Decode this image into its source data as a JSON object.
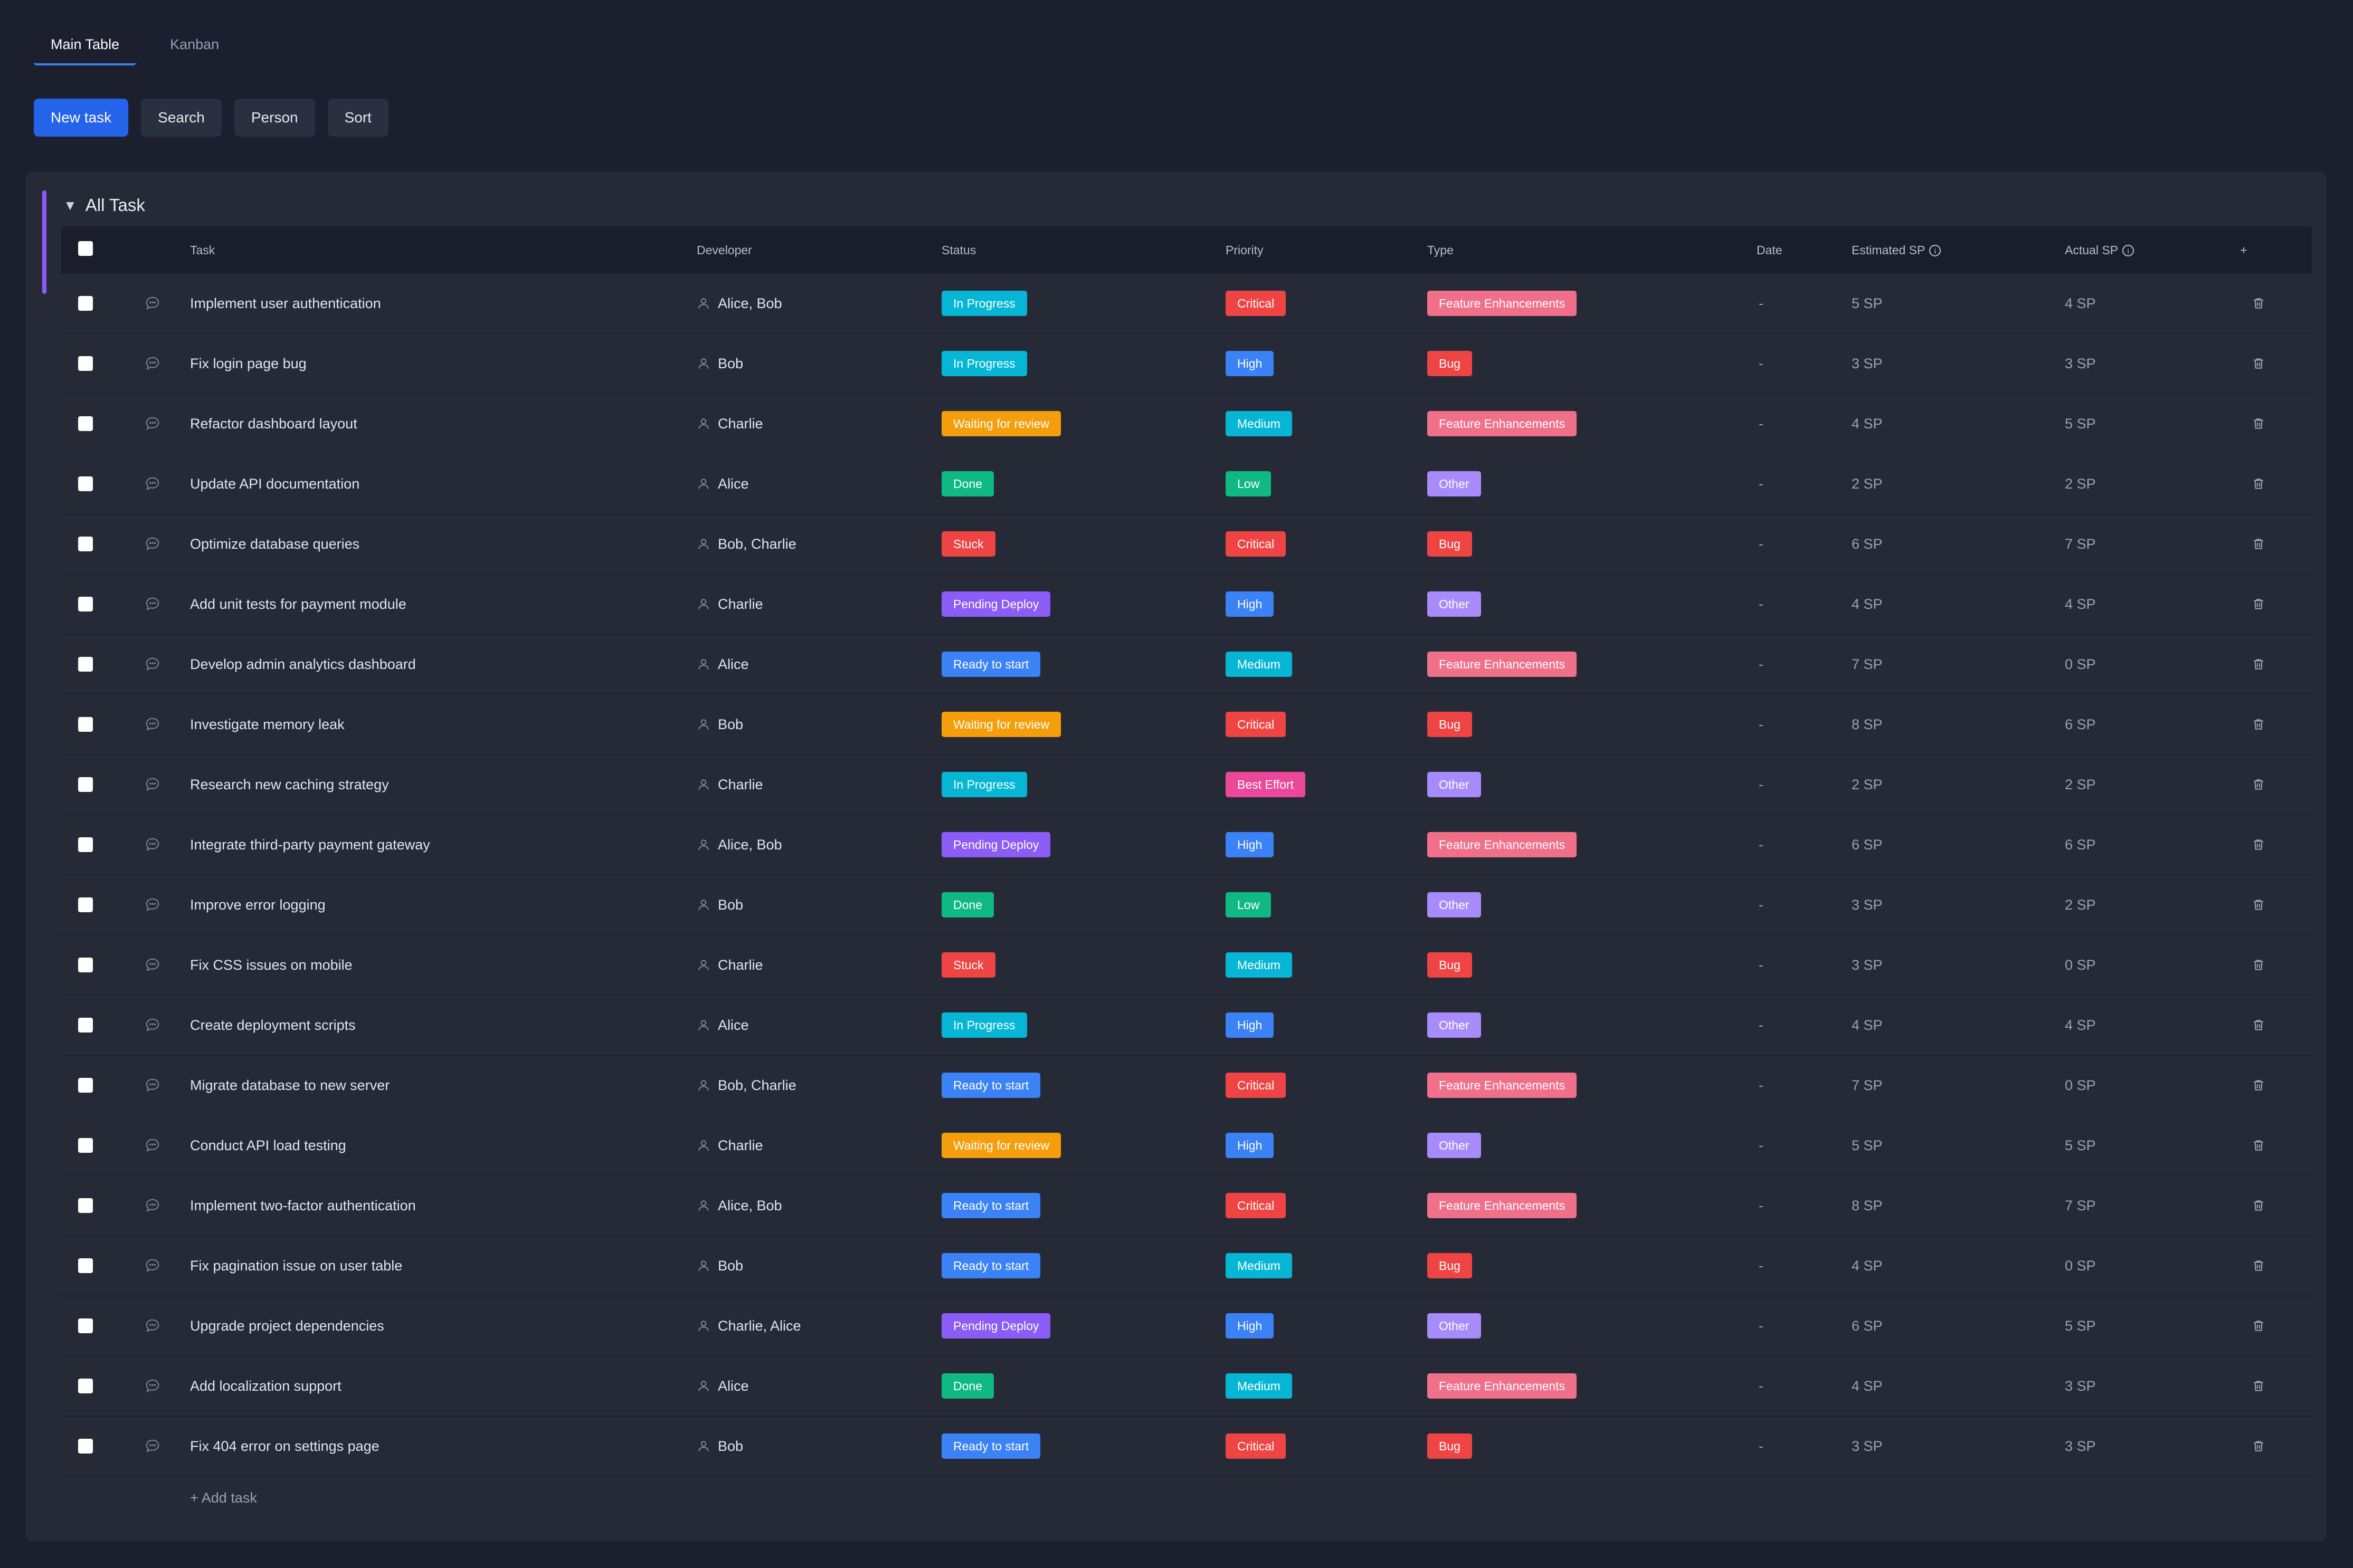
{
  "tabs": [
    {
      "label": "Main Table",
      "active": true
    },
    {
      "label": "Kanban",
      "active": false
    }
  ],
  "toolbar": {
    "new_task": "New task",
    "search": "Search",
    "person": "Person",
    "sort": "Sort"
  },
  "group": {
    "title": "All Task",
    "accent_color": "#8b5cf6",
    "add_task": "+ Add task"
  },
  "columns": {
    "task": "Task",
    "developer": "Developer",
    "status": "Status",
    "priority": "Priority",
    "type": "Type",
    "date": "Date",
    "estimated": "Estimated SP",
    "actual": "Actual SP",
    "add": "+"
  },
  "colors": {
    "In Progress": "#06b6d4",
    "Waiting for review": "#f59e0b",
    "Done": "#10b981",
    "Stuck": "#ef4444",
    "Pending Deploy": "#8b5cf6",
    "Ready to start": "#3b82f6",
    "Critical": "#ef4444",
    "High": "#3b82f6",
    "Medium": "#06b6d4",
    "Low": "#10b981",
    "Best Effort": "#ec4899",
    "Feature Enhancements": "#f0708a",
    "Bug": "#ef4444",
    "Other": "#a78bfa"
  },
  "rows": [
    {
      "task": "Implement user authentication",
      "developer": "Alice, Bob",
      "status": "In Progress",
      "priority": "Critical",
      "type": "Feature Enhancements",
      "date": "-",
      "estimated": "5 SP",
      "actual": "4 SP"
    },
    {
      "task": "Fix login page bug",
      "developer": "Bob",
      "status": "In Progress",
      "priority": "High",
      "type": "Bug",
      "date": "-",
      "estimated": "3 SP",
      "actual": "3 SP"
    },
    {
      "task": "Refactor dashboard layout",
      "developer": "Charlie",
      "status": "Waiting for review",
      "priority": "Medium",
      "type": "Feature Enhancements",
      "date": "-",
      "estimated": "4 SP",
      "actual": "5 SP"
    },
    {
      "task": "Update API documentation",
      "developer": "Alice",
      "status": "Done",
      "priority": "Low",
      "type": "Other",
      "date": "-",
      "estimated": "2 SP",
      "actual": "2 SP"
    },
    {
      "task": "Optimize database queries",
      "developer": "Bob, Charlie",
      "status": "Stuck",
      "priority": "Critical",
      "type": "Bug",
      "date": "-",
      "estimated": "6 SP",
      "actual": "7 SP"
    },
    {
      "task": "Add unit tests for payment module",
      "developer": "Charlie",
      "status": "Pending Deploy",
      "priority": "High",
      "type": "Other",
      "date": "-",
      "estimated": "4 SP",
      "actual": "4 SP"
    },
    {
      "task": "Develop admin analytics dashboard",
      "developer": "Alice",
      "status": "Ready to start",
      "priority": "Medium",
      "type": "Feature Enhancements",
      "date": "-",
      "estimated": "7 SP",
      "actual": "0 SP"
    },
    {
      "task": "Investigate memory leak",
      "developer": "Bob",
      "status": "Waiting for review",
      "priority": "Critical",
      "type": "Bug",
      "date": "-",
      "estimated": "8 SP",
      "actual": "6 SP"
    },
    {
      "task": "Research new caching strategy",
      "developer": "Charlie",
      "status": "In Progress",
      "priority": "Best Effort",
      "type": "Other",
      "date": "-",
      "estimated": "2 SP",
      "actual": "2 SP"
    },
    {
      "task": "Integrate third-party payment gateway",
      "developer": "Alice, Bob",
      "status": "Pending Deploy",
      "priority": "High",
      "type": "Feature Enhancements",
      "date": "-",
      "estimated": "6 SP",
      "actual": "6 SP"
    },
    {
      "task": "Improve error logging",
      "developer": "Bob",
      "status": "Done",
      "priority": "Low",
      "type": "Other",
      "date": "-",
      "estimated": "3 SP",
      "actual": "2 SP"
    },
    {
      "task": "Fix CSS issues on mobile",
      "developer": "Charlie",
      "status": "Stuck",
      "priority": "Medium",
      "type": "Bug",
      "date": "-",
      "estimated": "3 SP",
      "actual": "0 SP"
    },
    {
      "task": "Create deployment scripts",
      "developer": "Alice",
      "status": "In Progress",
      "priority": "High",
      "type": "Other",
      "date": "-",
      "estimated": "4 SP",
      "actual": "4 SP"
    },
    {
      "task": "Migrate database to new server",
      "developer": "Bob, Charlie",
      "status": "Ready to start",
      "priority": "Critical",
      "type": "Feature Enhancements",
      "date": "-",
      "estimated": "7 SP",
      "actual": "0 SP"
    },
    {
      "task": "Conduct API load testing",
      "developer": "Charlie",
      "status": "Waiting for review",
      "priority": "High",
      "type": "Other",
      "date": "-",
      "estimated": "5 SP",
      "actual": "5 SP"
    },
    {
      "task": "Implement two-factor authentication",
      "developer": "Alice, Bob",
      "status": "Ready to start",
      "priority": "Critical",
      "type": "Feature Enhancements",
      "date": "-",
      "estimated": "8 SP",
      "actual": "7 SP"
    },
    {
      "task": "Fix pagination issue on user table",
      "developer": "Bob",
      "status": "Ready to start",
      "priority": "Medium",
      "type": "Bug",
      "date": "-",
      "estimated": "4 SP",
      "actual": "0 SP"
    },
    {
      "task": "Upgrade project dependencies",
      "developer": "Charlie, Alice",
      "status": "Pending Deploy",
      "priority": "High",
      "type": "Other",
      "date": "-",
      "estimated": "6 SP",
      "actual": "5 SP"
    },
    {
      "task": "Add localization support",
      "developer": "Alice",
      "status": "Done",
      "priority": "Medium",
      "type": "Feature Enhancements",
      "date": "-",
      "estimated": "4 SP",
      "actual": "3 SP"
    },
    {
      "task": "Fix 404 error on settings page",
      "developer": "Bob",
      "status": "Ready to start",
      "priority": "Critical",
      "type": "Bug",
      "date": "-",
      "estimated": "3 SP",
      "actual": "3 SP"
    }
  ]
}
